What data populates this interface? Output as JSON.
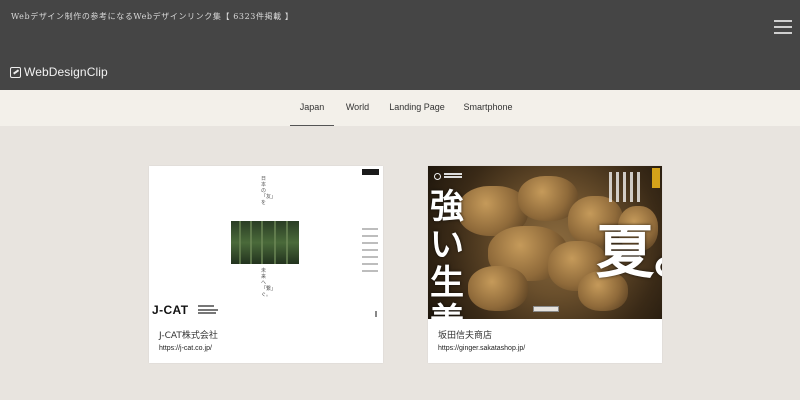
{
  "header": {
    "tagline": "Webデザイン制作の参考になるWebデザインリンク集【 6323件掲載 】",
    "logo_text": "WebDesignClip",
    "menu_icon": "hamburger-icon"
  },
  "nav": {
    "items": [
      {
        "label": "Japan",
        "active": true
      },
      {
        "label": "World",
        "active": false
      },
      {
        "label": "Landing Page",
        "active": false
      },
      {
        "label": "Smartphone",
        "active": false
      }
    ]
  },
  "cards": [
    {
      "title": "J-CAT株式会社",
      "url": "https://j-cat.co.jp/",
      "thumbnail": {
        "logo": "J-CAT",
        "headline_top": "日本の「友」を",
        "headline_bottom": "未来へ「繋」ぐ。"
      }
    },
    {
      "title": "坂田信夫商店",
      "url": "https://ginger.sakatashop.jp/",
      "thumbnail": {
        "headline_left": "強い生姜",
        "headline_right": "夏。"
      }
    }
  ],
  "colors": {
    "header_bg": "#454545",
    "nav_bg": "#f3f0ea",
    "page_bg": "#e8e4df",
    "card_bg": "#ffffff",
    "accent_yellow": "#d4a21a"
  }
}
